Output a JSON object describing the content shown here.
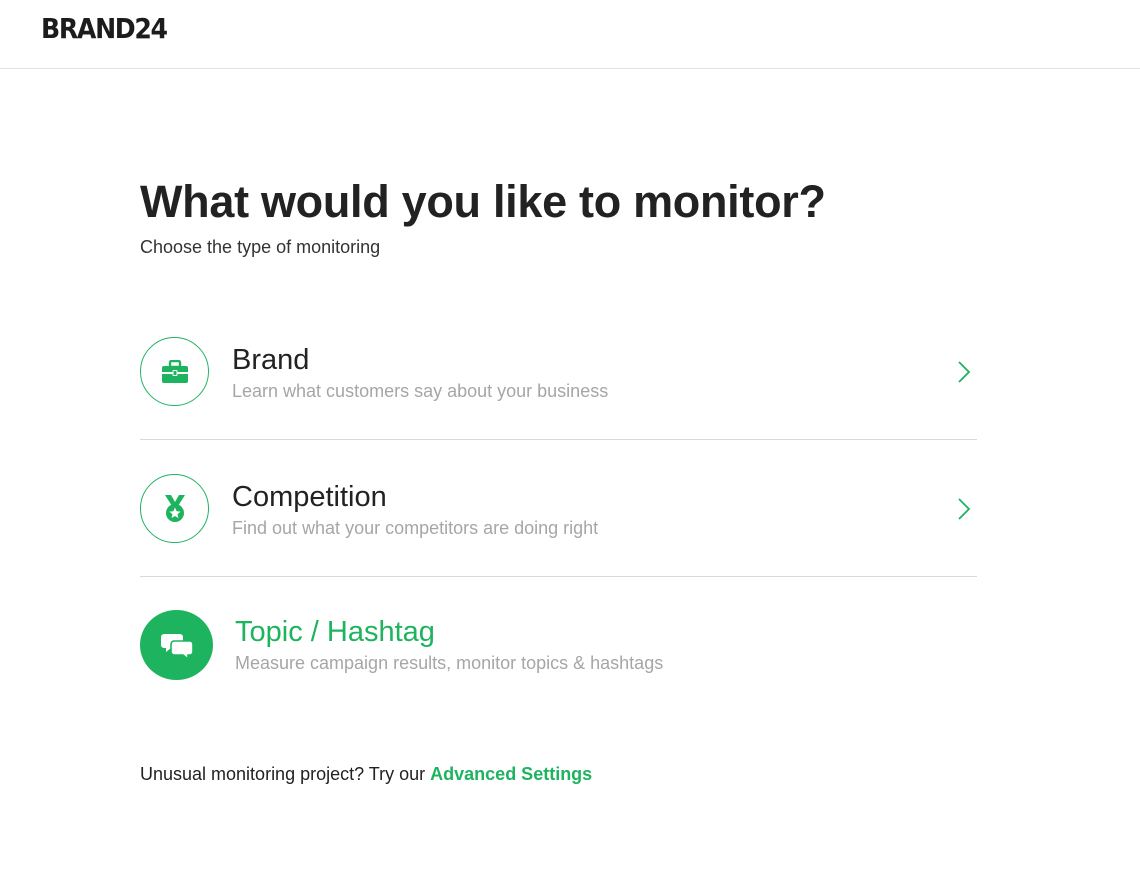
{
  "brand": {
    "logo_text": "BRAND24"
  },
  "main": {
    "title": "What would you like to monitor?",
    "subtitle": "Choose the type of monitoring"
  },
  "options": [
    {
      "title": "Brand",
      "description": "Learn what customers say about your business",
      "icon": "briefcase-icon"
    },
    {
      "title": "Competition",
      "description": "Find out what your competitors are doing right",
      "icon": "medal-icon"
    },
    {
      "title": "Topic / Hashtag",
      "description": "Measure campaign results, monitor topics & hashtags",
      "icon": "chat-bubbles-icon"
    }
  ],
  "footer": {
    "prefix": "Unusual monitoring project? Try our",
    "link": "Advanced Settings"
  },
  "colors": {
    "accent": "#1eb35f",
    "muted": "#a6a6a6",
    "text": "#222222"
  }
}
